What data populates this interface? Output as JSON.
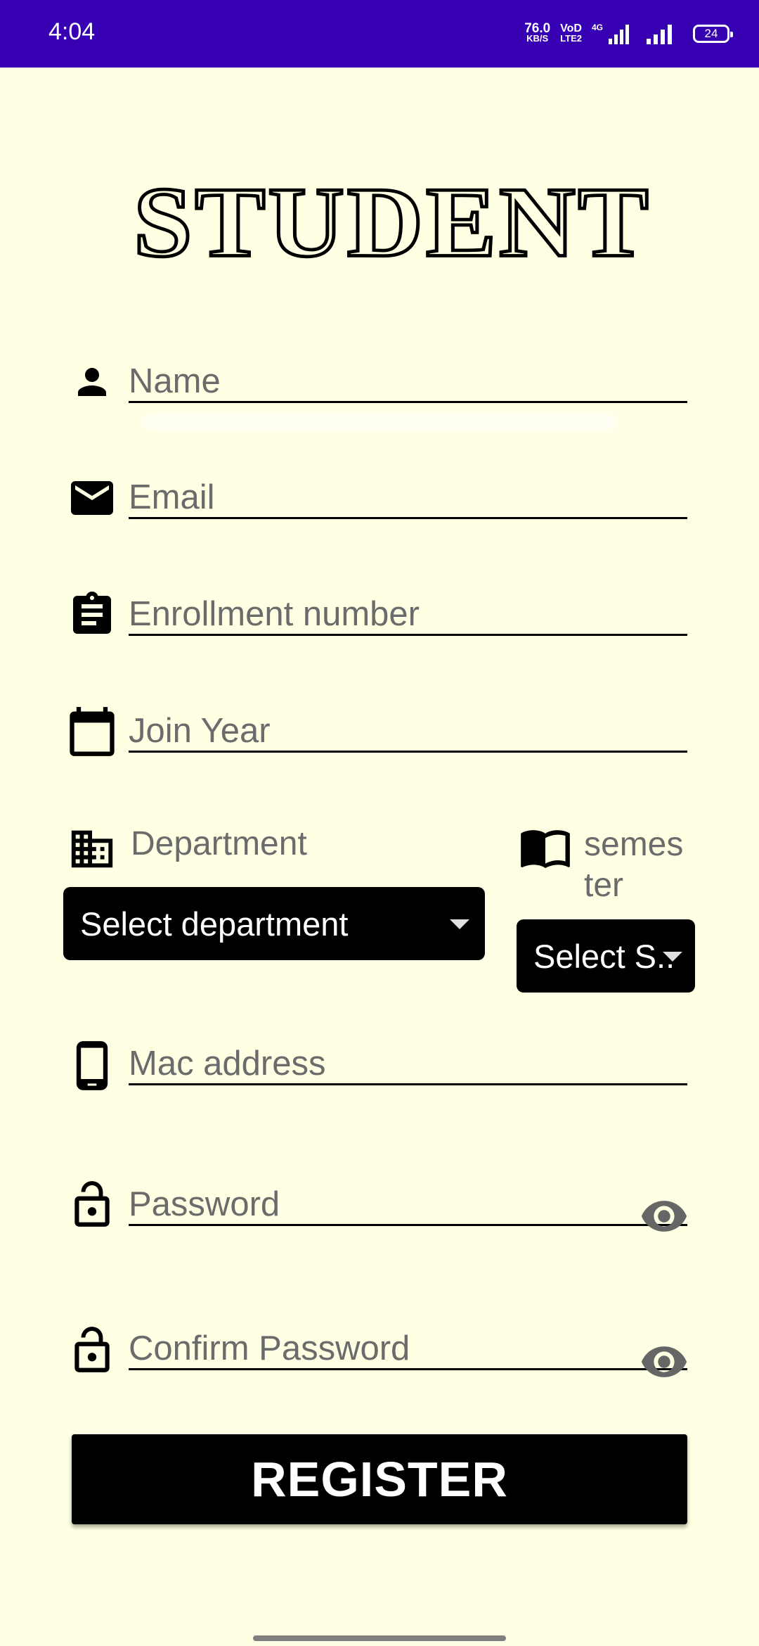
{
  "status_bar": {
    "time": "4:04",
    "net_speed": "76.0",
    "net_unit": "KB/S",
    "volte_top": "VoD",
    "volte_bottom": "LTE2",
    "network": "4G",
    "battery": "24"
  },
  "header": {
    "title": "STUDENT"
  },
  "form": {
    "name_placeholder": "Name",
    "email_placeholder": "Email",
    "enrollment_placeholder": "Enrollment number",
    "join_year_placeholder": "Join Year",
    "department_label": "Department",
    "department_selected": "Select department",
    "semester_label_line1": "semes",
    "semester_label_line2": "ter",
    "semester_selected": "Select S..",
    "mac_placeholder": "Mac address",
    "password_placeholder": "Password",
    "confirm_password_placeholder": "Confirm Password",
    "register_label": "REGISTER"
  },
  "icons": {
    "name": "person-icon",
    "email": "mail-icon",
    "enrollment": "clipboard-icon",
    "join_year": "calendar-icon",
    "department": "building-icon",
    "semester": "book-icon",
    "mac": "phone-icon",
    "password": "lock-open-icon",
    "visibility": "eye-icon"
  },
  "colors": {
    "status_bar": "#3700B3",
    "background": "#FFFFE3",
    "primary": "#000000"
  }
}
